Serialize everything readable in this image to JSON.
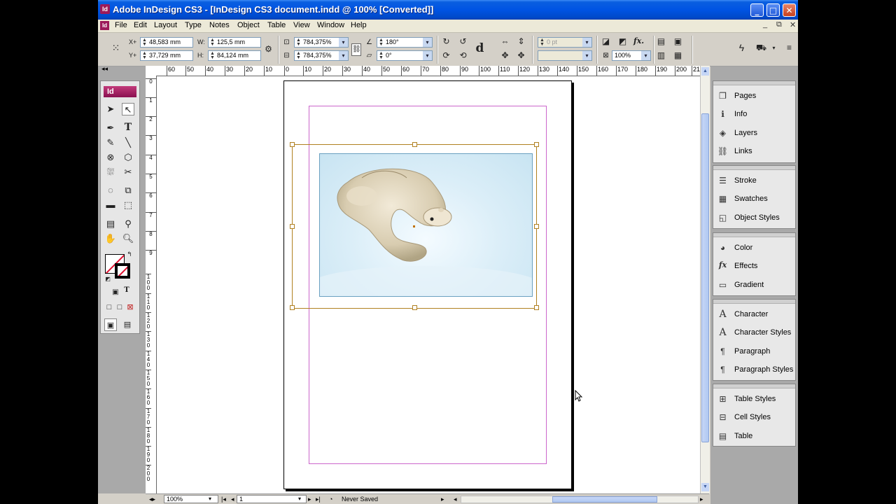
{
  "window": {
    "title": "Adobe InDesign CS3 - [InDesign CS3 document.indd @ 100% [Converted]]",
    "app_icon": "Id",
    "controls": {
      "minimize": "_",
      "maximize": "□",
      "close": "✕"
    }
  },
  "menu": {
    "doc_icon": "Id",
    "items": [
      "File",
      "Edit",
      "Layout",
      "Type",
      "Notes",
      "Object",
      "Table",
      "View",
      "Window",
      "Help"
    ],
    "doc_controls": [
      "_",
      "⧉",
      "✕"
    ]
  },
  "control_panel": {
    "x_label": "X+",
    "x_value": "48,583 mm",
    "y_label": "Y+",
    "y_value": "37,729 mm",
    "w_label": "W:",
    "w_value": "125,5 mm",
    "h_label": "H:",
    "h_value": "84,124 mm",
    "scale_x": "784,375%",
    "scale_y": "784,375%",
    "rotation": "180°",
    "shear": "0°",
    "stroke_weight": "0 pt",
    "opacity": "100%",
    "d_glyph": "d"
  },
  "tools": {
    "brand": "Id"
  },
  "ruler": {
    "h_ticks": [
      "60",
      "50",
      "40",
      "30",
      "20",
      "10",
      "0",
      "10",
      "20",
      "30",
      "40",
      "50",
      "60",
      "70",
      "80",
      "90",
      "100",
      "110",
      "120",
      "130",
      "140",
      "150",
      "160",
      "170",
      "180",
      "190",
      "200",
      "21"
    ],
    "v_ticks": [
      "0",
      "1",
      "2",
      "3",
      "4",
      "5",
      "6",
      "7",
      "8",
      "9",
      "1 0 0",
      "1 1 0",
      "1 2 0",
      "1 3 0",
      "1 4 0",
      "1 5 0",
      "1 6 0",
      "1 7 0",
      "1 8 0",
      "1 9 0",
      "2 0 0",
      "2 1 0",
      "2 2 0",
      "2 3 0"
    ]
  },
  "panels": {
    "groups": [
      {
        "items": [
          {
            "label": "Pages",
            "icon": "pages-icon"
          },
          {
            "label": "Info",
            "icon": "info-icon"
          },
          {
            "label": "Layers",
            "icon": "layers-icon"
          },
          {
            "label": "Links",
            "icon": "links-icon"
          }
        ]
      },
      {
        "items": [
          {
            "label": "Stroke",
            "icon": "stroke-icon"
          },
          {
            "label": "Swatches",
            "icon": "swatches-icon"
          },
          {
            "label": "Object Styles",
            "icon": "object-styles-icon"
          }
        ]
      },
      {
        "items": [
          {
            "label": "Color",
            "icon": "color-icon"
          },
          {
            "label": "Effects",
            "icon": "effects-icon"
          },
          {
            "label": "Gradient",
            "icon": "gradient-icon"
          }
        ]
      },
      {
        "items": [
          {
            "label": "Character",
            "icon": "character-icon"
          },
          {
            "label": "Character Styles",
            "icon": "character-styles-icon"
          },
          {
            "label": "Paragraph",
            "icon": "paragraph-icon"
          },
          {
            "label": "Paragraph Styles",
            "icon": "paragraph-styles-icon"
          }
        ]
      },
      {
        "items": [
          {
            "label": "Table Styles",
            "icon": "table-styles-icon"
          },
          {
            "label": "Cell Styles",
            "icon": "cell-styles-icon"
          },
          {
            "label": "Table",
            "icon": "table-icon"
          }
        ]
      }
    ]
  },
  "status": {
    "zoom": "100%",
    "page": "1",
    "save_state": "Never Saved"
  },
  "colors": {
    "title_bar": "#0054e3",
    "margin_guide": "#cc66cc",
    "frame_selection": "#b08020",
    "indesign_brand": "#9c1a5a"
  }
}
